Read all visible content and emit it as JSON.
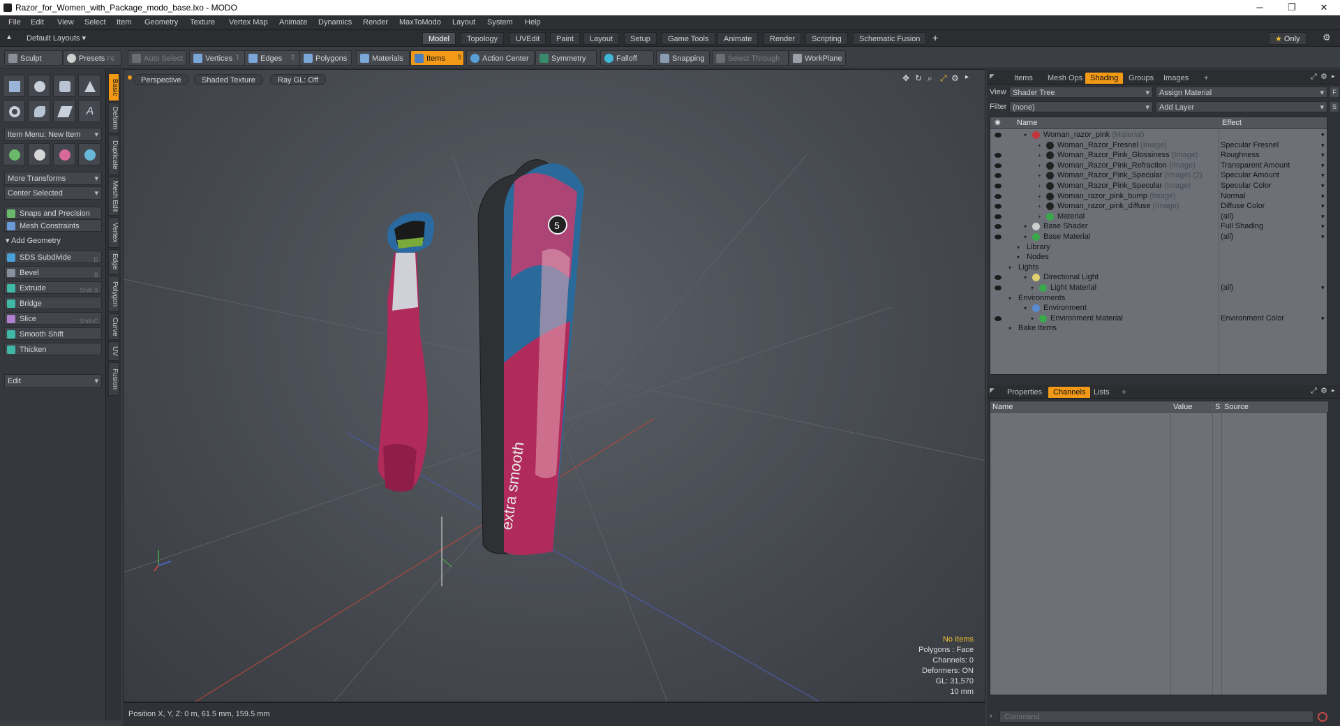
{
  "window": {
    "title": "Razor_for_Women_with_Package_modo_base.lxo - MODO"
  },
  "menu": [
    "File",
    "Edit",
    "View",
    "Select",
    "Item",
    "Geometry",
    "Texture",
    "Vertex Map",
    "Animate",
    "Dynamics",
    "Render",
    "MaxToModo",
    "Layout",
    "System",
    "Help"
  ],
  "layouts": {
    "default_label": "Default Layouts",
    "tabs": [
      "Model",
      "Topology",
      "UVEdit",
      "Paint",
      "Layout",
      "Setup",
      "Game Tools",
      "Animate",
      "Render",
      "Scripting",
      "Schematic Fusion"
    ],
    "active": "Model",
    "only_label": "Only",
    "plus": "+"
  },
  "toolbar": {
    "sculpt": "Sculpt",
    "presets": "Presets",
    "presets_key": "F6",
    "auto_select": "Auto Select",
    "vertices": "Vertices",
    "vertices_key": "1",
    "edges": "Edges",
    "edges_key": "2",
    "polygons": "Polygons",
    "materials": "Materials",
    "items": "Items",
    "items_key": "5",
    "action_center": "Action Center",
    "symmetry": "Symmetry",
    "falloff": "Falloff",
    "snapping": "Snapping",
    "select_through": "Select Through",
    "workplane": "WorkPlane"
  },
  "left_panel": {
    "item_menu": "Item Menu: New Item",
    "more_transforms": "More Transforms",
    "center_selected": "Center Selected",
    "snaps": "Snaps and Precision",
    "mesh_constraints": "Mesh Constraints",
    "add_geometry": "Add Geometry",
    "tools": [
      {
        "label": "SDS Subdivide",
        "key": "D",
        "color": "#4aa0d8"
      },
      {
        "label": "Bevel",
        "key": "B",
        "color": "#8a8fa0"
      },
      {
        "label": "Extrude",
        "key": "Shift-X",
        "color": "#3fb8a8"
      },
      {
        "label": "Bridge",
        "key": "",
        "color": "#3fb8a8"
      },
      {
        "label": "Slice",
        "key": "Shift-C",
        "color": "#b080d0"
      },
      {
        "label": "Smooth Shift",
        "key": "",
        "color": "#3fb8a8"
      },
      {
        "label": "Thicken",
        "key": "",
        "color": "#3fb8a8"
      }
    ],
    "edit": "Edit",
    "vtabs": [
      "Basic",
      "Deform",
      "Duplicate",
      "Mesh Edit",
      "Vertex",
      "Edge",
      "Polygon",
      "Curve",
      "UV",
      "Fusion"
    ]
  },
  "viewport": {
    "perspective": "Perspective",
    "shading": "Shaded Texture",
    "raygl": "Ray GL: Off",
    "package_text": "extra smooth",
    "package_badge": "5",
    "info": {
      "no_items": "No Items",
      "polygons": "Polygons : Face",
      "channels": "Channels: 0",
      "deformers": "Deformers: ON",
      "gl": "GL: 31,570",
      "unit": "10 mm"
    }
  },
  "status": {
    "position": "Position X, Y, Z:   0 m, 61.5 mm, 159.5 mm"
  },
  "right_panel": {
    "top_tabs": [
      "Items",
      "Mesh Ops",
      "Shading",
      "Groups",
      "Images"
    ],
    "active_top": "Shading",
    "view_label": "View",
    "view_value": "Shader Tree",
    "assign_material": "Assign Material",
    "filter_label": "Filter",
    "filter_value": "(none)",
    "add_layer": "Add Layer",
    "col_name": "Name",
    "col_effect": "Effect",
    "tree": [
      {
        "name": "Woman_razor_pink",
        "sub": "(Material)",
        "effect": "",
        "indent": 60,
        "ball": "#c0363a",
        "eye": true,
        "arr": true
      },
      {
        "name": "Woman_Razor_Fresnel",
        "sub": "(Image)",
        "effect": "Specular Fresnel",
        "indent": 80,
        "ball": "#222",
        "eye": false,
        "arr": true
      },
      {
        "name": "Woman_Razor_Pink_Glossiness",
        "sub": "(Image)",
        "effect": "Roughness",
        "indent": 80,
        "ball": "#222",
        "eye": true,
        "arr": true
      },
      {
        "name": "Woman_Razor_Pink_Refraction",
        "sub": "(Image)",
        "effect": "Transparent Amount",
        "indent": 80,
        "ball": "#222",
        "eye": true,
        "arr": true
      },
      {
        "name": "Woman_Razor_Pink_Specular",
        "sub": "(Image) (2)",
        "effect": "Specular Amount",
        "indent": 80,
        "ball": "#222",
        "eye": true,
        "arr": true
      },
      {
        "name": "Woman_Razor_Pink_Specular",
        "sub": "(Image)",
        "effect": "Specular Color",
        "indent": 80,
        "ball": "#222",
        "eye": true,
        "arr": true
      },
      {
        "name": "Woman_razor_pink_bump",
        "sub": "(Image)",
        "effect": "Normal",
        "indent": 80,
        "ball": "#222",
        "eye": true,
        "arr": true
      },
      {
        "name": "Woman_razor_pink_diffuse",
        "sub": "(Image)",
        "effect": "Diffuse Color",
        "indent": 80,
        "ball": "#222",
        "eye": true,
        "arr": true
      },
      {
        "name": "Material",
        "sub": "",
        "effect": "(all)",
        "indent": 80,
        "ball": "#3aa84a",
        "eye": true,
        "arr": true
      },
      {
        "name": "Base Shader",
        "sub": "",
        "effect": "Full Shading",
        "indent": 60,
        "ball": "#cfcfcf",
        "eye": true,
        "arr": true
      },
      {
        "name": "Base Material",
        "sub": "",
        "effect": "(all)",
        "indent": 60,
        "ball": "#3aa84a",
        "eye": true,
        "arr": true
      },
      {
        "name": "Library",
        "sub": "",
        "effect": "",
        "indent": 50,
        "ball": "",
        "eye": false,
        "arr": false
      },
      {
        "name": "Nodes",
        "sub": "",
        "effect": "",
        "indent": 50,
        "ball": "",
        "eye": false,
        "arr": false
      },
      {
        "name": "Lights",
        "sub": "",
        "effect": "",
        "indent": 38,
        "ball": "",
        "eye": false,
        "arr": false
      },
      {
        "name": "Directional Light",
        "sub": "",
        "effect": "",
        "indent": 60,
        "ball": "#e0d070",
        "eye": true,
        "arr": false
      },
      {
        "name": "Light Material",
        "sub": "",
        "effect": "(all)",
        "indent": 70,
        "ball": "#3aa84a",
        "eye": true,
        "arr": true
      },
      {
        "name": "Environments",
        "sub": "",
        "effect": "",
        "indent": 38,
        "ball": "",
        "eye": false,
        "arr": false
      },
      {
        "name": "Environment",
        "sub": "",
        "effect": "",
        "indent": 60,
        "ball": "#5a8ad0",
        "eye": false,
        "arr": false
      },
      {
        "name": "Environment Material",
        "sub": "",
        "effect": "Environment Color",
        "indent": 70,
        "ball": "#3aa84a",
        "eye": true,
        "arr": true
      },
      {
        "name": "Bake Items",
        "sub": "",
        "effect": "",
        "indent": 38,
        "ball": "",
        "eye": false,
        "arr": false
      }
    ],
    "bottom_tabs": [
      "Properties",
      "Channels",
      "Lists"
    ],
    "active_bottom": "Channels",
    "chan_cols": [
      "Name",
      "Value",
      "S",
      "Source"
    ],
    "command_placeholder": "Command"
  }
}
